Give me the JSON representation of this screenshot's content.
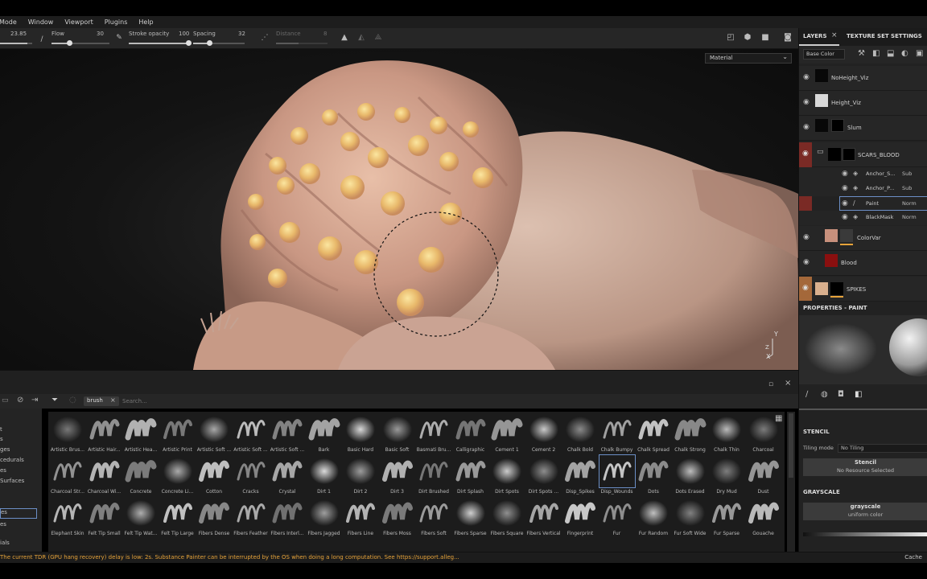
{
  "menu": {
    "items": [
      "Mode",
      "Window",
      "Viewport",
      "Plugins",
      "Help"
    ]
  },
  "tool_options": {
    "size_value": "23.85",
    "flow_label": "Flow",
    "flow_value": "30",
    "flow_level": 0.3,
    "stroke_opacity_label": "Stroke opacity",
    "stroke_opacity_value": "100",
    "stroke_opacity_level": 1.0,
    "spacing_label": "Spacing",
    "spacing_value": "32",
    "spacing_level": 0.32,
    "distance_label": "Distance",
    "distance_value": "8"
  },
  "viewport": {
    "material_select": "Material",
    "axis_y": "Y",
    "axis_x": "X",
    "axis_z": "Z"
  },
  "shelf": {
    "search_tag": "brush",
    "search_placeholder": "Search...",
    "left_items": [
      "t",
      "s",
      "ges",
      "cedurals",
      "es",
      "Surfaces",
      "es",
      "es",
      "ials"
    ],
    "brushes_row1": [
      "Artistic Brus...",
      "Artistic Hair...",
      "Artistic Hea...",
      "Artistic Print",
      "Artistic Soft ...",
      "Artistic Soft ...",
      "Artistic Soft ...",
      "Bark",
      "Basic Hard",
      "Basic Soft",
      "Basmati Bru...",
      "Calligraphic",
      "Cement 1",
      "Cement 2",
      "Chalk Bold",
      "Chalk Bumpy",
      "Chalk Spread",
      "Chalk Strong",
      "Chalk Thin",
      "Charcoal"
    ],
    "brushes_row2": [
      "Charcoal Str...",
      "Charcoal Wi...",
      "Concrete",
      "Concrete Li...",
      "Cotton",
      "Cracks",
      "Crystal",
      "Dirt 1",
      "Dirt 2",
      "Dirt 3",
      "Dirt Brushed",
      "Dirt Splash",
      "Dirt Spots",
      "Dirt Spots ...",
      "Disp_Spikes",
      "Disp_Wounds",
      "Dots",
      "Dots Erased",
      "Dry Mud",
      "Dust"
    ],
    "brushes_row3": [
      "Elephant Skin",
      "Felt Tip Small",
      "Felt Tip Wat...",
      "Felt Tip Large",
      "Fibers Dense",
      "Fibers Feather",
      "Fibers Interl...",
      "Fibers Jagged",
      "Fibers Line",
      "Fibers Moss",
      "Fibers Soft",
      "Fibers Sparse",
      "Fibers Square",
      "Fibers Vertical",
      "Fingerprint",
      "Fur",
      "Fur Random",
      "Fur Soft Wide",
      "Fur Sparse",
      "Gouache"
    ],
    "selected": "Disp_Wounds"
  },
  "status": {
    "warning": "The current TDR (GPU hang recovery) delay is low: 2s. Substance Painter can be interrupted by the OS when doing a long computation. See https://support.alleg...",
    "cache": "Cache"
  },
  "right_panel": {
    "tab_layers": "LAYERS",
    "tab_texture_set": "TEXTURE SET SETTINGS",
    "channel_select": "Base Color",
    "layers": [
      {
        "name": "NoHeight_Viz"
      },
      {
        "name": "Height_Viz"
      },
      {
        "name": "Slum"
      },
      {
        "name": "SCARS_BLOOD"
      },
      {
        "name": "ColorVar"
      },
      {
        "name": "Blood"
      },
      {
        "name": "SPIKES"
      }
    ],
    "sublayers": [
      {
        "name": "Anchor_S...",
        "blend": "Sub"
      },
      {
        "name": "Anchor_P...",
        "blend": "Sub"
      },
      {
        "name": "Paint",
        "blend": "Norm"
      },
      {
        "name": "BlackMask",
        "blend": "Norm"
      }
    ],
    "properties_title": "PROPERTIES - PAINT",
    "stencil_title": "STENCIL",
    "tiling_label": "Tiling mode",
    "tiling_value": "No Tiling",
    "stencil_slot_title": "Stencil",
    "stencil_slot_sub": "No Resource Selected",
    "grayscale_title": "GRAYSCALE",
    "grayscale_slot_title": "grayscale",
    "grayscale_slot_sub": "uniform color"
  },
  "colors": {
    "accent_orange": "#e6a33a",
    "layer_mark_red": "#7a2a25",
    "layer_mark_orange": "#a4683a",
    "selection_blue": "#6c8fc7"
  }
}
